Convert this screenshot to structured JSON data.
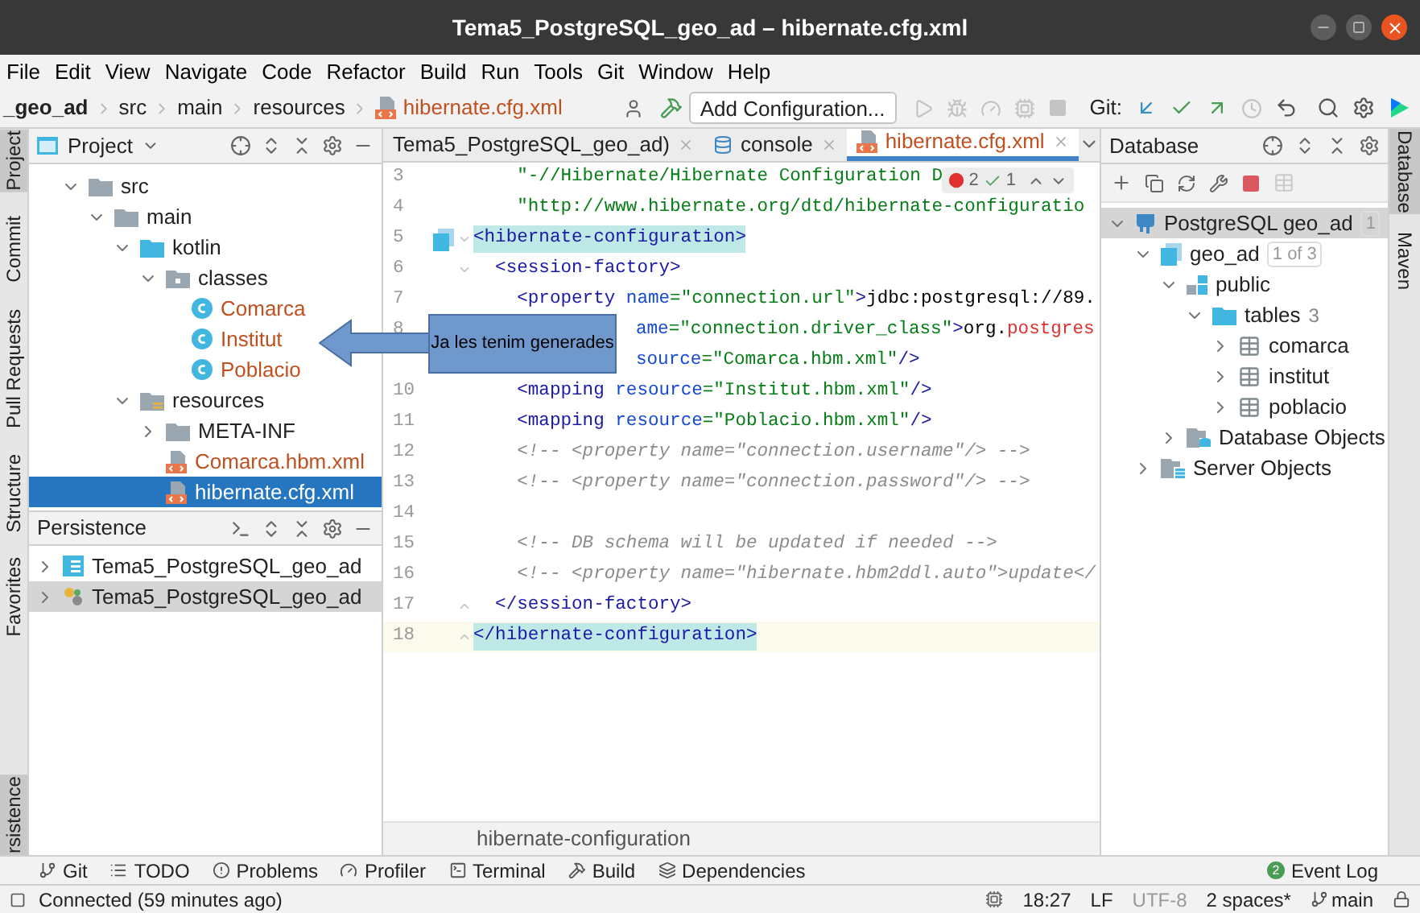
{
  "window": {
    "title": "Tema5_PostgreSQL_geo_ad – hibernate.cfg.xml"
  },
  "menu": [
    "File",
    "Edit",
    "View",
    "Navigate",
    "Code",
    "Refactor",
    "Build",
    "Run",
    "Tools",
    "Git",
    "Window",
    "Help"
  ],
  "navbar": {
    "breadcrumbs": [
      {
        "label": "_geo_ad",
        "kind": "project"
      },
      {
        "label": "src",
        "kind": "folder"
      },
      {
        "label": "main",
        "kind": "folder"
      },
      {
        "label": "resources",
        "kind": "folder"
      },
      {
        "label": "hibernate.cfg.xml",
        "kind": "file"
      }
    ],
    "run_config": "Add Configuration...",
    "git_label": "Git:"
  },
  "left_tool_tabs": [
    {
      "label": "Project",
      "selected": true
    },
    {
      "label": "Commit",
      "selected": false
    },
    {
      "label": "Pull Requests",
      "selected": false
    },
    {
      "label": "Structure",
      "selected": false
    },
    {
      "label": "Favorites",
      "selected": false
    },
    {
      "label": "rsistence",
      "selected": true
    }
  ],
  "project_panel": {
    "title": "Project",
    "tree": [
      {
        "label": "src",
        "kind": "folder",
        "expanded": true,
        "selected": false,
        "children": [
          {
            "label": "main",
            "kind": "folder",
            "expanded": true,
            "selected": false,
            "children": [
              {
                "label": "kotlin",
                "kind": "source-folder",
                "expanded": true,
                "selected": false,
                "children": [
                  {
                    "label": "classes",
                    "kind": "package",
                    "expanded": true,
                    "selected": false,
                    "children": [
                      {
                        "label": "Comarca",
                        "kind": "class",
                        "selected": false,
                        "color": "#c0501f"
                      },
                      {
                        "label": "Institut",
                        "kind": "class",
                        "selected": false,
                        "color": "#c0501f"
                      },
                      {
                        "label": "Poblacio",
                        "kind": "class",
                        "selected": false,
                        "color": "#c0501f"
                      }
                    ]
                  }
                ]
              },
              {
                "label": "resources",
                "kind": "resource-folder",
                "expanded": true,
                "selected": false,
                "children": [
                  {
                    "label": "META-INF",
                    "kind": "folder",
                    "expanded": false,
                    "selected": false
                  },
                  {
                    "label": "Comarca.hbm.xml",
                    "kind": "xml",
                    "selected": false,
                    "color": "#c0501f"
                  },
                  {
                    "label": "hibernate.cfg.xml",
                    "kind": "xml",
                    "selected": true
                  }
                ]
              }
            ]
          }
        ]
      }
    ]
  },
  "persistence_panel": {
    "title": "Persistence",
    "items": [
      {
        "label": "Tema5_PostgreSQL_geo_ad",
        "kind": "module",
        "selected": false
      },
      {
        "label": "Tema5_PostgreSQL_geo_ad",
        "kind": "facet",
        "selected": true
      }
    ]
  },
  "editor": {
    "tabs": [
      {
        "label": "Tema5_PostgreSQL_geo_ad)",
        "kind": "plain",
        "selected": false
      },
      {
        "label": "console",
        "kind": "console",
        "selected": false
      },
      {
        "label": "hibernate.cfg.xml",
        "kind": "xml",
        "selected": true
      }
    ],
    "inspections": {
      "errors": "2",
      "warnings": "1"
    },
    "lines": [
      {
        "number": "3",
        "kind": "plain",
        "current": false,
        "segments": [
          {
            "text": "    \"-//Hibernate/Hibernate Configuration D",
            "kind": "value"
          }
        ]
      },
      {
        "number": "4",
        "kind": "plain",
        "current": false,
        "segments": [
          {
            "text": "    \"http://www.hibernate.org/dtd/hibernate-configuratio",
            "kind": "value"
          }
        ]
      },
      {
        "number": "5",
        "kind": "datasource-start",
        "current": false,
        "segments": [
          {
            "text": "<hibernate-configuration>",
            "kind": "tag",
            "matched": true
          }
        ]
      },
      {
        "number": "6",
        "kind": "fold-start",
        "current": false,
        "segments": [
          {
            "text": "  <session-factory>",
            "kind": "tag",
            "matched": false
          }
        ]
      },
      {
        "number": "7",
        "kind": "plain",
        "current": false,
        "segments": [
          {
            "text": "    <property ",
            "kind": "tag",
            "matched": false
          },
          {
            "text": "name",
            "kind": "attr"
          },
          {
            "text": "=\"connection.url\"",
            "kind": "value"
          },
          {
            "text": ">",
            "kind": "tag",
            "matched": false
          },
          {
            "text": "jdbc:postgresql://89.",
            "kind": "text"
          }
        ]
      },
      {
        "number": "8",
        "kind": "partial",
        "current": false,
        "segments": [
          {
            "text": "ame",
            "kind": "attr"
          },
          {
            "text": "=\"connection.driver_class\"",
            "kind": "value"
          },
          {
            "text": ">",
            "kind": "tag",
            "matched": false
          },
          {
            "text": "org.",
            "kind": "text"
          },
          {
            "text": "postgres",
            "kind": "error"
          }
        ]
      },
      {
        "kind": "partial",
        "current": false,
        "segments": [
          {
            "text": "source",
            "kind": "attr"
          },
          {
            "text": "=\"Comarca.hbm.xml\"",
            "kind": "value"
          },
          {
            "text": "/>",
            "kind": "tag",
            "matched": false
          }
        ]
      },
      {
        "number": "10",
        "kind": "plain",
        "current": false,
        "segments": [
          {
            "text": "    <mapping ",
            "kind": "tag",
            "matched": false
          },
          {
            "text": "resource",
            "kind": "attr"
          },
          {
            "text": "=\"Institut.hbm.xml\"",
            "kind": "value"
          },
          {
            "text": "/>",
            "kind": "tag",
            "matched": false
          }
        ]
      },
      {
        "number": "11",
        "kind": "plain",
        "current": false,
        "segments": [
          {
            "text": "    <mapping ",
            "kind": "tag",
            "matched": false
          },
          {
            "text": "resource",
            "kind": "attr"
          },
          {
            "text": "=\"Poblacio.hbm.xml\"",
            "kind": "value"
          },
          {
            "text": "/>",
            "kind": "tag",
            "matched": false
          }
        ]
      },
      {
        "number": "12",
        "kind": "plain",
        "current": false,
        "segments": [
          {
            "text": "    <!-- <property name=\"connection.username\"/> -->",
            "kind": "comment"
          }
        ]
      },
      {
        "number": "13",
        "kind": "plain",
        "current": false,
        "segments": [
          {
            "text": "    <!-- <property name=\"connection.password\"/> -->",
            "kind": "comment"
          }
        ]
      },
      {
        "number": "14",
        "kind": "plain",
        "current": false
      },
      {
        "number": "15",
        "kind": "plain",
        "current": false,
        "segments": [
          {
            "text": "    <!-- DB schema will be updated if needed -->",
            "kind": "comment"
          }
        ]
      },
      {
        "number": "16",
        "kind": "plain",
        "current": false,
        "segments": [
          {
            "text": "    <!-- <property name=\"hibernate.hbm2ddl.auto\">update</",
            "kind": "comment"
          }
        ]
      },
      {
        "number": "17",
        "kind": "fold-end",
        "current": false,
        "segments": [
          {
            "text": "  </session-factory>",
            "kind": "tag",
            "matched": false
          }
        ]
      },
      {
        "number": "18",
        "kind": "fold-end",
        "current": true,
        "segments": [
          {
            "text": "</hibernate-configuration>",
            "kind": "tag",
            "matched": true
          }
        ]
      }
    ],
    "breadcrumb": "hibernate-configuration"
  },
  "database_panel": {
    "title": "Database",
    "tree": [
      {
        "label": "PostgreSQL geo_ad",
        "kind": "datasource",
        "badge": "1",
        "expanded": true,
        "selected": true,
        "children": [
          {
            "label": "geo_ad",
            "kind": "database",
            "badge": "1 of 3",
            "expanded": true,
            "selected": false,
            "children": [
              {
                "label": "public",
                "kind": "schema",
                "expanded": true,
                "selected": false,
                "children": [
                  {
                    "label": "tables",
                    "kind": "folder",
                    "count": "3",
                    "expanded": true,
                    "selected": false,
                    "children": [
                      {
                        "label": "comarca",
                        "kind": "table",
                        "expanded": false,
                        "selected": false
                      },
                      {
                        "label": "institut",
                        "kind": "table",
                        "expanded": false,
                        "selected": false
                      },
                      {
                        "label": "poblacio",
                        "kind": "table",
                        "expanded": false,
                        "selected": false
                      }
                    ]
                  }
                ]
              },
              {
                "label": "Database Objects",
                "kind": "group",
                "expanded": false,
                "selected": false
              }
            ]
          },
          {
            "label": "Server Objects",
            "kind": "server",
            "expanded": false,
            "selected": false
          }
        ]
      }
    ]
  },
  "right_tool_tabs": [
    {
      "label": "Database",
      "selected": true
    },
    {
      "label": "Maven",
      "selected": false
    }
  ],
  "bottom_tabs": [
    {
      "label": "Git",
      "kind": "git"
    },
    {
      "label": "TODO",
      "kind": "todo"
    },
    {
      "label": "Problems",
      "kind": "problems"
    },
    {
      "label": "Profiler",
      "kind": "profiler"
    },
    {
      "label": "Terminal",
      "kind": "terminal"
    },
    {
      "label": "Build",
      "kind": "build"
    },
    {
      "label": "Dependencies",
      "kind": "dependencies"
    }
  ],
  "event_log": {
    "label": "Event Log",
    "count": "2"
  },
  "status_bar": {
    "message": "Connected (59 minutes ago)",
    "position": "18:27",
    "line_separator": "LF",
    "encoding": "UTF-8",
    "indent": "2 spaces*",
    "branch": "main"
  },
  "callout": {
    "text": "Ja les tenim generades"
  }
}
